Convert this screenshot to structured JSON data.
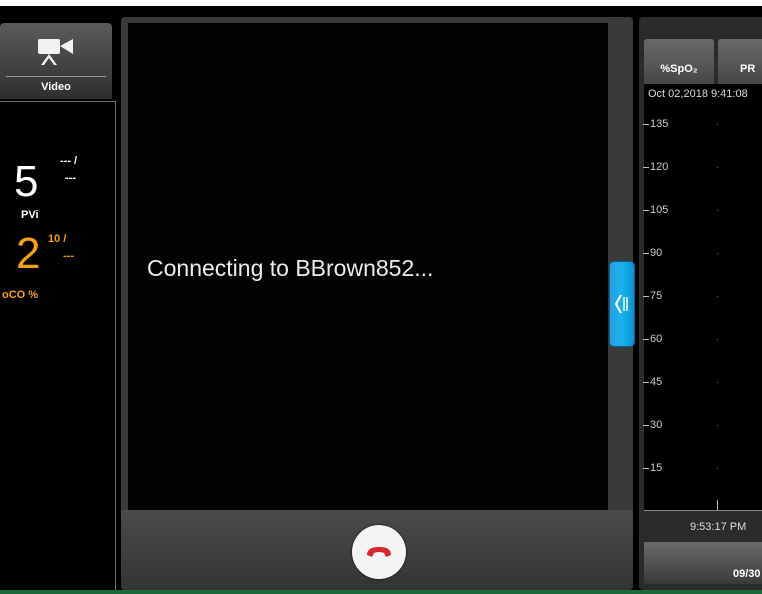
{
  "left": {
    "video_tab_label": "Video",
    "pvi_value": "5",
    "pvi_alarm_limits": "--- /\n---",
    "pvi_label": "PVi",
    "spoc_value": "2",
    "spoc_alarm_high": "10 /",
    "spoc_alarm_low": "---",
    "spoc_label": "oCO %"
  },
  "call": {
    "status_text": "Connecting to BBrown852...",
    "end_call_icon": "end-call-icon"
  },
  "right": {
    "tab_spo2": "%SpO₂",
    "tab_pr": "PR",
    "timestamp": "Oct 02,2018 9:41:08",
    "y_ticks": [
      "135",
      "120",
      "105",
      "90",
      "75",
      "60",
      "45",
      "30",
      "15"
    ],
    "time_label": "9:53:17 PM",
    "date_label": "09/30"
  },
  "colors": {
    "accent_orange": "#f5a11a",
    "collapse_blue": "#18b3ee",
    "end_call_red": "#d9262e"
  }
}
